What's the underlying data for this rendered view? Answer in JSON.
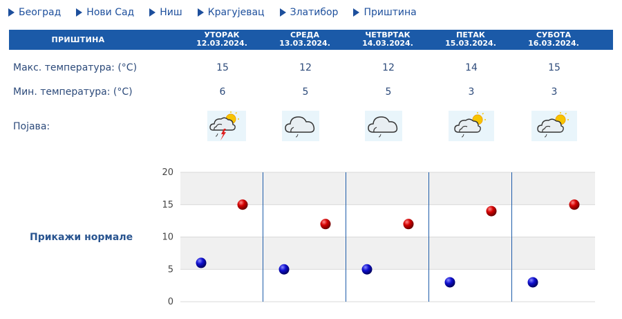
{
  "nav": {
    "cities": [
      "Београд",
      "Нови Сад",
      "Ниш",
      "Крагујевац",
      "Златибор",
      "Приштина"
    ]
  },
  "forecast": {
    "city": "ПРИШТИНА",
    "days": [
      {
        "name": "УТОРАК",
        "date": "12.03.2024.",
        "icon": "cloud-sun-lightning-icon"
      },
      {
        "name": "СРЕДА",
        "date": "13.03.2024.",
        "icon": "cloud-rain-icon"
      },
      {
        "name": "ЧЕТВРТАК",
        "date": "14.03.2024.",
        "icon": "cloud-rain-icon"
      },
      {
        "name": "ПЕТАК",
        "date": "15.03.2024.",
        "icon": "cloud-sun-rain-icon"
      },
      {
        "name": "СУБОТА",
        "date": "16.03.2024.",
        "icon": "cloud-sun-rain-icon"
      }
    ],
    "labels": {
      "max": "Макс. температура: (°C)",
      "min": "Мин. температура: (°C)",
      "phenomenon": "Појава:"
    },
    "max": [
      "15",
      "12",
      "12",
      "14",
      "15"
    ],
    "min": [
      "6",
      "5",
      "5",
      "3",
      "3"
    ],
    "show_normals": "Прикажи нормале"
  },
  "colors": {
    "header_bg": "#1b5aa8",
    "max_dot": "#cc0000",
    "min_dot": "#1a1acc"
  },
  "chart_data": {
    "type": "scatter",
    "categories": [
      "12.03.2024.",
      "13.03.2024.",
      "14.03.2024.",
      "15.03.2024.",
      "16.03.2024."
    ],
    "series": [
      {
        "values": [
          6,
          5,
          5,
          3,
          3
        ],
        "color": "#1a1acc"
      },
      {
        "values": [
          15,
          12,
          12,
          14,
          15
        ],
        "color": "#cc0000"
      }
    ],
    "ylim": [
      0,
      20
    ],
    "yticks": [
      "0",
      "5",
      "10",
      "15",
      "20"
    ],
    "grid": true,
    "banded_background": true
  }
}
